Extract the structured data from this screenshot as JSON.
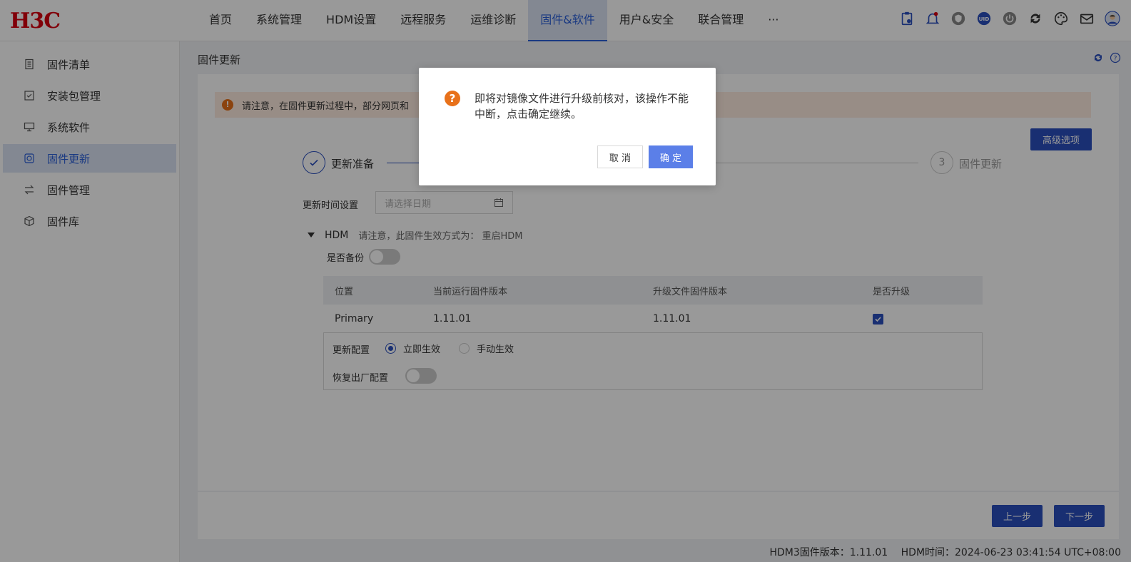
{
  "header": {
    "logo": "H3C",
    "nav": [
      "首页",
      "系统管理",
      "HDM设置",
      "远程服务",
      "运维诊断",
      "固件&软件",
      "用户&安全",
      "联合管理",
      "···"
    ],
    "active_nav_index": 5,
    "icons": [
      "clipboard-icon",
      "bell-icon",
      "shield-icon",
      "uid-icon",
      "power-icon",
      "refresh-icon",
      "palette-icon",
      "mail-icon",
      "user-avatar-icon"
    ]
  },
  "sidebar": {
    "items": [
      {
        "label": "固件清单",
        "icon": "list-icon"
      },
      {
        "label": "安装包管理",
        "icon": "package-icon"
      },
      {
        "label": "系统软件",
        "icon": "monitor-icon"
      },
      {
        "label": "固件更新",
        "icon": "update-icon"
      },
      {
        "label": "固件管理",
        "icon": "swap-icon"
      },
      {
        "label": "固件库",
        "icon": "cube-icon"
      }
    ],
    "active_index": 3
  },
  "main": {
    "title": "固件更新",
    "alert": "请注意，在固件更新过程中，部分网页和",
    "advanced_button": "高级选项",
    "steps": {
      "step1": "更新准备",
      "step3_number": "3",
      "step3": "固件更新"
    },
    "time_label": "更新时间设置",
    "date_placeholder": "请选择日期",
    "hdm_name": "HDM",
    "hdm_note": "请注意，此固件生效方式为： 重启HDM",
    "backup_label": "是否备份",
    "table": {
      "headers": [
        "位置",
        "当前运行固件版本",
        "升级文件固件版本",
        "是否升级"
      ],
      "rows": [
        {
          "location": "Primary",
          "current": "1.11.01",
          "upgrade": "1.11.01",
          "checked": true
        }
      ]
    },
    "config_label": "更新配置",
    "radio_immediate": "立即生效",
    "radio_manual": "手动生效",
    "restore_label": "恢复出厂配置",
    "prev_button": "上一步",
    "next_button": "下一步"
  },
  "footer": {
    "version": "HDM3固件版本：1.11.01",
    "time": "HDM时间：2024-06-23 03:41:54 UTC+08:00"
  },
  "dialog": {
    "message": "即将对镜像文件进行升级前核对，该操作不能中断，点击确定继续。",
    "cancel": "取 消",
    "ok": "确 定"
  },
  "colors": {
    "brand": "#d7000f",
    "primary": "#2a4fbf",
    "warning": "#e8711a"
  }
}
